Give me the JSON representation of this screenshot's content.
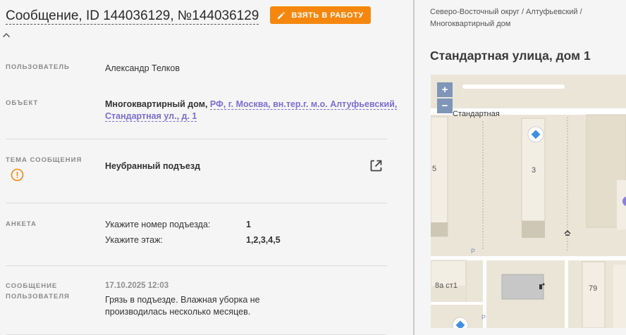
{
  "message": {
    "title": "Сообщение, ID 144036129, №144036129",
    "take_button": "ВЗЯТЬ В РАБОТУ"
  },
  "fields": {
    "user": {
      "label": "ПОЛЬЗОВАТЕЛЬ",
      "value": "Александр Телков"
    },
    "object": {
      "label": "ОБЪЕКТ",
      "type": "Многоквартирный дом,",
      "address_line1": "РФ, г. Москва, вн.тер.г. м.о. Алтуфьевский,",
      "address_line2": "Стандартная ул., д. 1"
    },
    "topic": {
      "label": "ТЕМА СООБЩЕНИЯ",
      "value": "Неубранный подъезд"
    },
    "survey": {
      "label": "АНКЕТА",
      "rows": [
        {
          "question": "Укажите номер подъезда:",
          "answer": "1"
        },
        {
          "question": "Укажите этаж:",
          "answer": "1,2,3,4,5"
        }
      ]
    },
    "user_message": {
      "label_line1": "СООБЩЕНИЕ",
      "label_line2": "ПОЛЬЗОВАТЕЛЯ",
      "date": "17.10.2025 12:03",
      "text_line1": "Грязь в подъезде. Влажная уборка не",
      "text_line2": "производилась несколько месяцев."
    }
  },
  "location": {
    "breadcrumb_line1": "Северо-Восточный округ / Алтуфьевский /",
    "breadcrumb_line2": "Многоквартирный дом",
    "address": "Стандартная улица, дом 1"
  },
  "map": {
    "zoom_in": "+",
    "zoom_out": "−",
    "street_label": "Стандартная",
    "building_labels": [
      "5",
      "3",
      "8а ст1",
      "79"
    ],
    "parking_label": "P"
  },
  "colors": {
    "accent": "#f5870f",
    "link": "#7b6fd0",
    "zoom": "#7f96b8"
  }
}
